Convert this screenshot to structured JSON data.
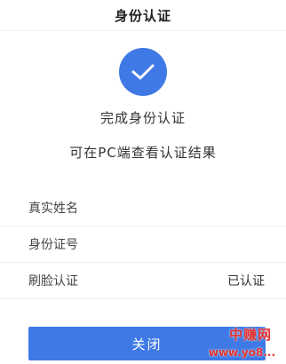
{
  "header": {
    "title": "身份认证"
  },
  "success": {
    "icon": "checkmark-icon",
    "title": "完成身份认证",
    "subtitle": "可在PC端查看认证结果"
  },
  "info": {
    "rows": [
      {
        "label": "真实姓名",
        "value": ""
      },
      {
        "label": "身份证号",
        "value": ""
      },
      {
        "label": "刷脸认证",
        "value": "已认证"
      }
    ]
  },
  "actions": {
    "close_label": "关闭"
  },
  "watermark": {
    "top": "中赚网",
    "bottom": "www.yo8..."
  },
  "colors": {
    "accent": "#3e79e6",
    "watermark": "#e0312f"
  }
}
